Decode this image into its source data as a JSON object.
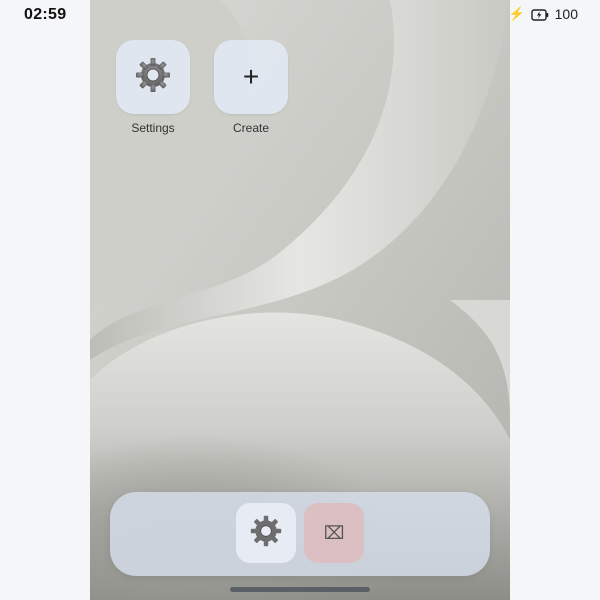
{
  "status_bar": {
    "time": "02:59",
    "charging_icon": "bolt-icon",
    "battery_icon": "battery-charging-icon",
    "battery_level": "100"
  },
  "home": {
    "apps": [
      {
        "label": "Settings",
        "icon": "gear-icon"
      },
      {
        "label": "Create",
        "icon": "plus-icon",
        "glyph": "+"
      }
    ]
  },
  "dock": {
    "items": [
      {
        "icon": "gear-icon"
      },
      {
        "icon": "missing-glyph-icon",
        "glyph": "⌧"
      }
    ]
  },
  "colors": {
    "dock_tile_accent": "#dcbfc3",
    "charging_bolt": "#e3b400"
  }
}
